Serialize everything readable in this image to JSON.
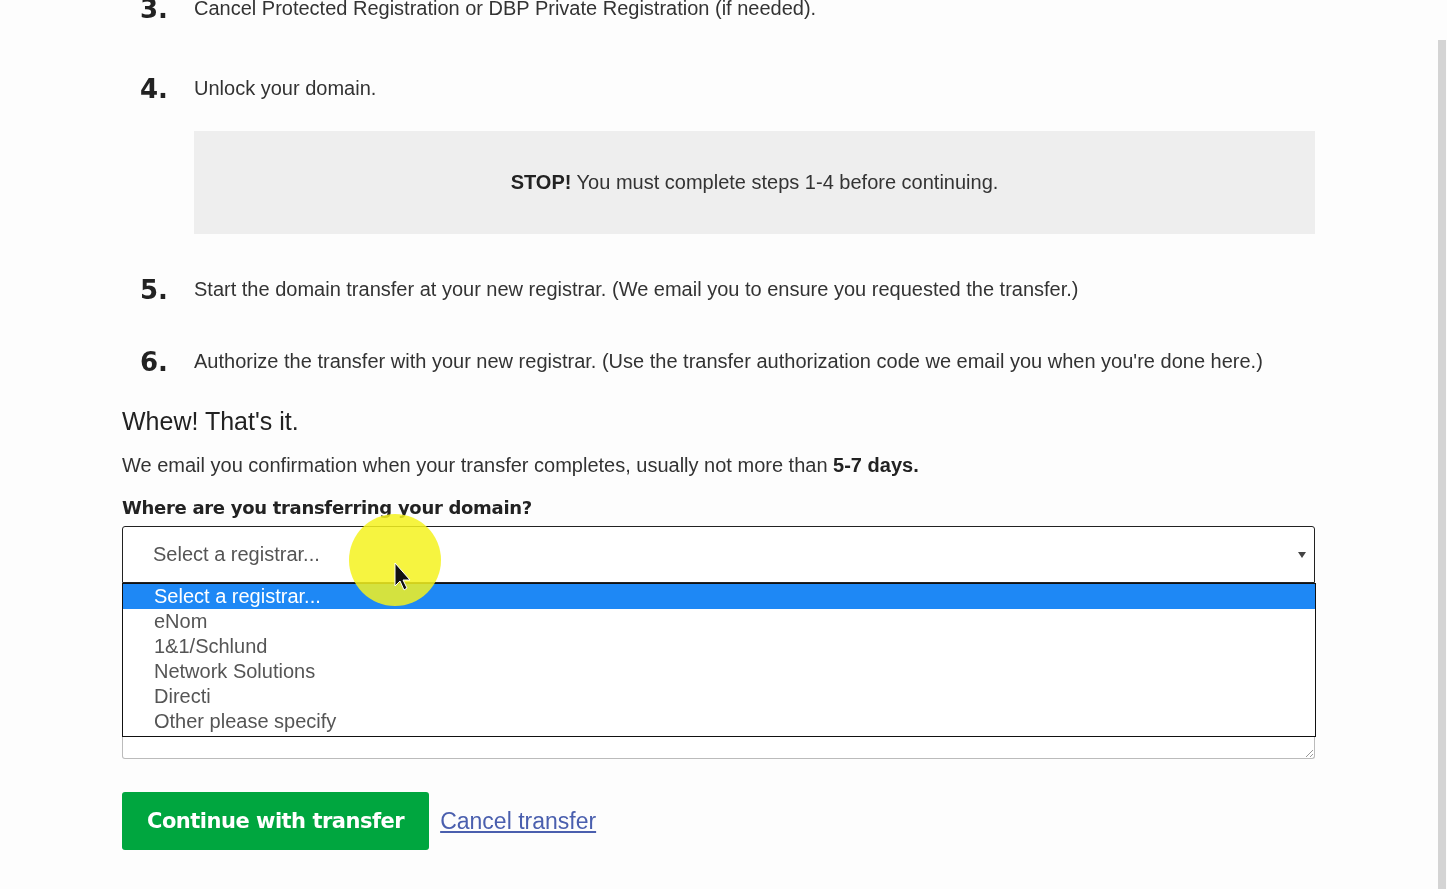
{
  "steps": [
    {
      "number": "3.",
      "text": "Cancel Protected Registration or DBP Private Registration (if needed)."
    },
    {
      "number": "4.",
      "text": "Unlock your domain.",
      "notice": "**STOP!** You must complete steps 1-4 before continuing."
    },
    {
      "number": "5.",
      "text": "Start the domain transfer at your new registrar. (We email you to ensure you requested the transfer.)"
    },
    {
      "number": "6.",
      "text": "Authorize the transfer with your new registrar. (Use the transfer authorization code we email you when you're done here.)"
    }
  ],
  "summary": {
    "heading": "Whew! That's it.",
    "text": "We email you confirmation when your transfer completes, usually not more than **5-7 days.**"
  },
  "form": {
    "question": "Where are you transferring your domain?",
    "select": {
      "value": "Select a registrar...",
      "expanded": true,
      "options": [
        {
          "label": "Select a registrar...",
          "selected": true
        },
        {
          "label": "eNom",
          "selected": false
        },
        {
          "label": "1&1/Schlund",
          "selected": false
        },
        {
          "label": "Network Solutions",
          "selected": false
        },
        {
          "label": "Directi",
          "selected": false
        },
        {
          "label": "Other please specify",
          "selected": false
        }
      ]
    }
  },
  "actions": {
    "primary": "Continue with transfer",
    "link": "Cancel transfer"
  }
}
